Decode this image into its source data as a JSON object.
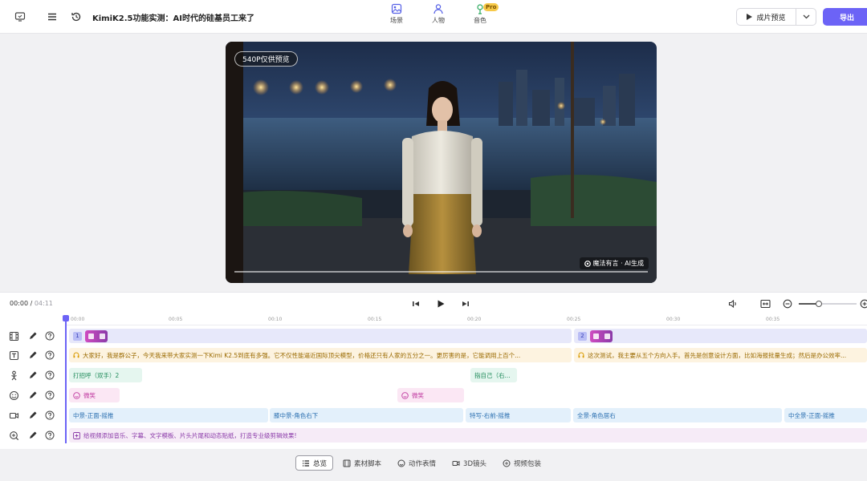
{
  "header": {
    "project_title": "KimiK2.5功能实测：AI时代的硅基员工来了",
    "nav": [
      {
        "label": "场景",
        "icon": "scene-icon"
      },
      {
        "label": "人物",
        "icon": "person-icon"
      },
      {
        "label": "音色",
        "icon": "voice-icon",
        "badge": "Pro"
      }
    ],
    "preview_label": "成片预览",
    "export_label": "导出"
  },
  "player": {
    "resolution_badge": "540P仅供预览",
    "watermark": "魔法有言 · AI生成",
    "progress_fraction": 0.0
  },
  "controls": {
    "current_time": "00:00",
    "separator": " / ",
    "total_time": "04:11",
    "zoom_level_fraction": 0.35
  },
  "timeline": {
    "ruler_ticks": [
      "00:00",
      "00:05",
      "00:10",
      "00:15",
      "00:20",
      "00:25",
      "00:30",
      "00:35"
    ],
    "scene_clips": [
      {
        "number": "1"
      },
      {
        "number": "2"
      }
    ],
    "script_clips": [
      {
        "text": "大家好，我是群公子，今天我来带大家实测一下Kimi K2.5到底有多强。它不仅性能逼近国际顶尖模型，价格还只有人家的五分之一。更厉害的是，它能调用上百个..."
      },
      {
        "text": "这次测试，我主要从五个方向入手。首先是创意设计方面，比如海报批量生成；然后是办公效率..."
      }
    ],
    "action_clips": [
      {
        "text": "打招呼（双手）2"
      },
      {
        "text": "指自己（右..."
      }
    ],
    "expression_clips": [
      {
        "text": "微笑"
      },
      {
        "text": "微笑"
      }
    ],
    "camera_clips": [
      {
        "text": "中景-正面-摇推"
      },
      {
        "text": "膝中景-角色右下"
      },
      {
        "text": "特写-右前-摇推"
      },
      {
        "text": "全景-角色居右"
      },
      {
        "text": "中全景-正面-摇推"
      }
    ],
    "packaging_hint": "给视频添加音乐、字幕、文字模板、片头片尾和动态贴纸，打造专业级剪辑效果!"
  },
  "bottom_tabs": [
    {
      "label": "总览",
      "active": true,
      "icon": "list-icon"
    },
    {
      "label": "素材脚本",
      "active": false,
      "icon": "film-icon"
    },
    {
      "label": "动作表情",
      "active": false,
      "icon": "smile-icon"
    },
    {
      "label": "3D镜头",
      "active": false,
      "icon": "camera-icon"
    },
    {
      "label": "视频包装",
      "active": false,
      "icon": "package-icon"
    }
  ],
  "colors": {
    "accent": "#6c63f6",
    "scene_track": "#e7e8fa",
    "script_track": "#fdf3e0",
    "action_track": "#e5f6ef",
    "expression_track": "#fbe7f4",
    "camera_track": "#e3f0fb",
    "packaging_track": "#f6ebf7"
  }
}
